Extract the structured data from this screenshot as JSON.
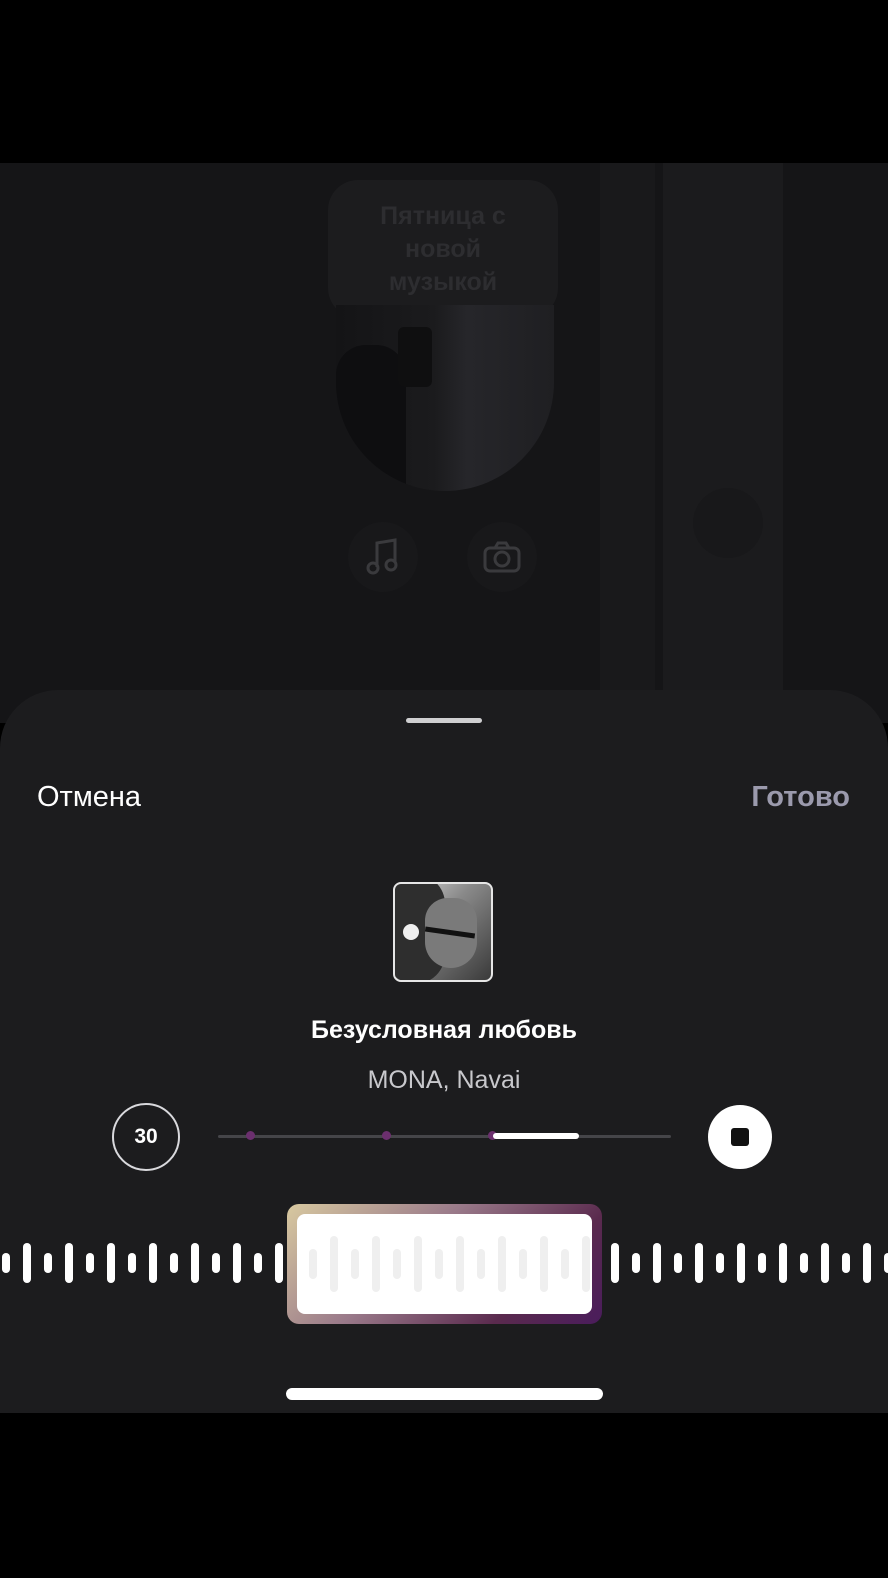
{
  "backdrop": {
    "story_text": "Пятница с новой музыкой",
    "icons": [
      "music-note-icon",
      "camera-icon"
    ]
  },
  "sheet": {
    "cancel_label": "Отмена",
    "done_label": "Готово"
  },
  "track": {
    "title": "Безусловная любовь",
    "artist": "MONA, Navai",
    "album_art": "album-cover"
  },
  "controls": {
    "duration_label": "30",
    "stop_icon": "stop-icon"
  },
  "colors": {
    "sheet_bg": "#1c1c1e",
    "accent_purple": "#6b2f6e",
    "done_color": "#9b9aad"
  }
}
